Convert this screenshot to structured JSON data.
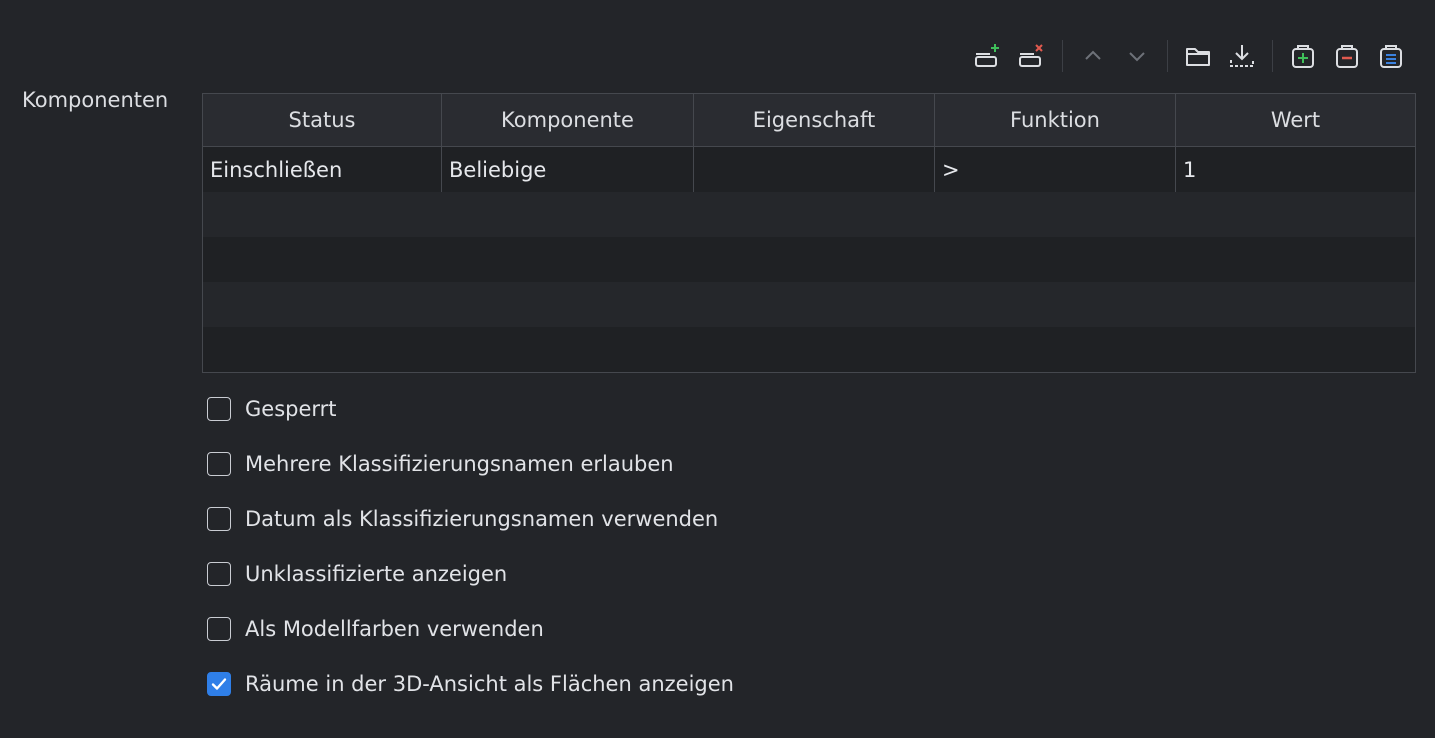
{
  "section": {
    "label": "Komponenten"
  },
  "toolbar": {
    "buttons": [
      {
        "name": "add-row-icon"
      },
      {
        "name": "remove-row-icon"
      },
      {
        "name": "move-up-icon"
      },
      {
        "name": "move-down-icon"
      },
      {
        "name": "open-folder-icon"
      },
      {
        "name": "download-icon"
      },
      {
        "name": "add-clipboard-icon"
      },
      {
        "name": "remove-clipboard-icon"
      },
      {
        "name": "list-clipboard-icon"
      }
    ]
  },
  "table": {
    "headers": [
      "Status",
      "Komponente",
      "Eigenschaft",
      "Funktion",
      "Wert"
    ],
    "rows": [
      [
        "Einschließen",
        "Beliebige",
        "",
        ">",
        "1"
      ]
    ]
  },
  "options": [
    {
      "label": "Gesperrt",
      "checked": false
    },
    {
      "label": "Mehrere Klassifizierungsnamen erlauben",
      "checked": false
    },
    {
      "label": "Datum als Klassifizierungsnamen verwenden",
      "checked": false
    },
    {
      "label": "Unklassifizierte anzeigen",
      "checked": false
    },
    {
      "label": "Als Modellfarben verwenden",
      "checked": false
    },
    {
      "label": "Räume in der 3D-Ansicht als Flächen anzeigen",
      "checked": true
    }
  ],
  "colors": {
    "add": "#3fbf5a",
    "remove": "#e05a4f",
    "list": "#3b82e0",
    "checked": "#2f7fe8"
  }
}
